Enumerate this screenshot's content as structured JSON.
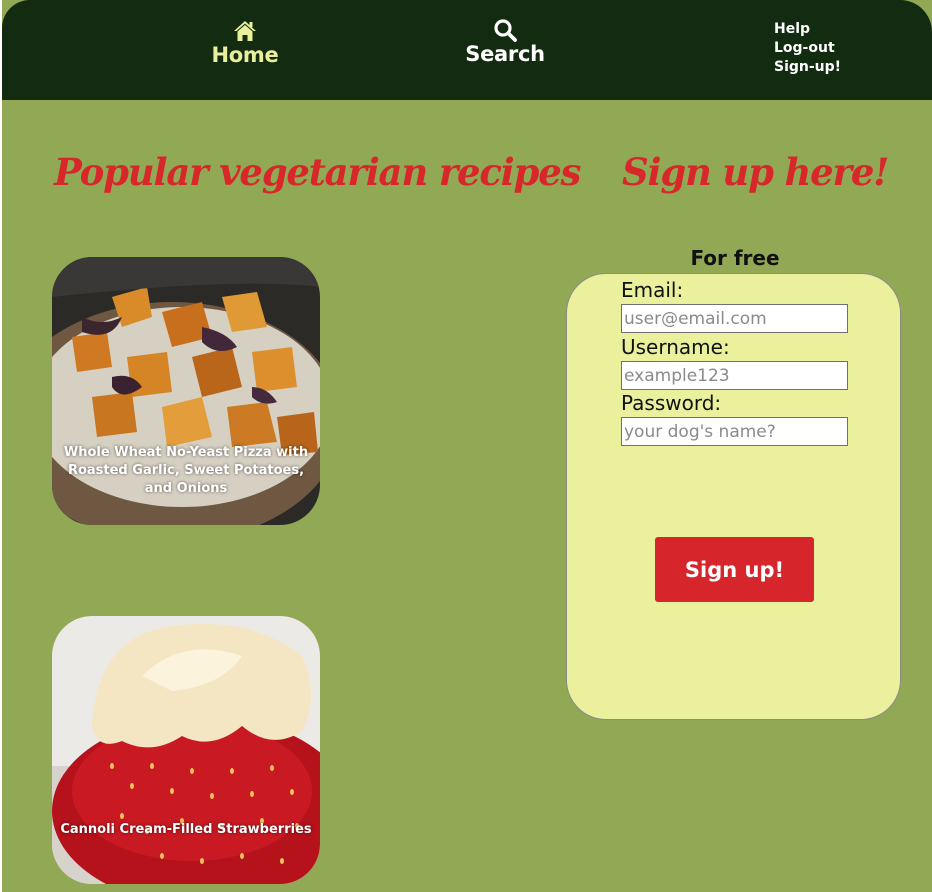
{
  "nav": {
    "home_label": "Home",
    "home_icon": "home-icon",
    "search_label": "Search",
    "search_icon": "search-icon",
    "links": [
      "Help",
      "Log-out",
      "Sign-up!"
    ]
  },
  "recipes": {
    "heading": "Popular vegetarian recipes",
    "items": [
      {
        "title": "Whole Wheat No-Yeast Pizza with Roasted Garlic, Sweet Potatoes, and Onions"
      },
      {
        "title": "Cannoli Cream-Filled Strawberries"
      }
    ]
  },
  "signup": {
    "heading": "Sign up here!",
    "subheading": "For free",
    "email_label": "Email:",
    "email_placeholder": "user@email.com",
    "username_label": "Username:",
    "username_placeholder": "example123",
    "password_label": "Password:",
    "password_placeholder": "your dog's name?",
    "button_label": "Sign up!"
  },
  "colors": {
    "topbar": "#132b11",
    "page_bg": "#91a854",
    "accent_red": "#d7272b",
    "form_bg": "#eaf09c",
    "home_active": "#e9ef9b"
  }
}
